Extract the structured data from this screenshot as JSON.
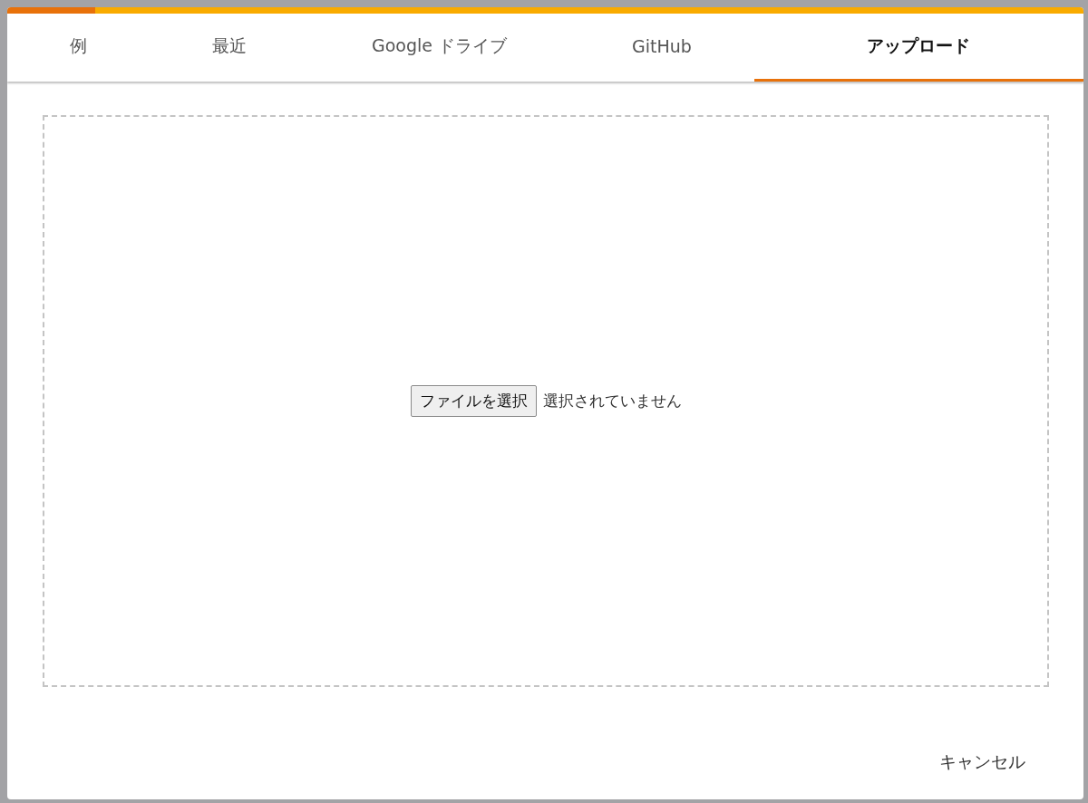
{
  "tabs": [
    {
      "label": "例",
      "selected": false
    },
    {
      "label": "最近",
      "selected": false
    },
    {
      "label": "Google ドライブ",
      "selected": false
    },
    {
      "label": "GitHub",
      "selected": false
    },
    {
      "label": "アップロード",
      "selected": true
    }
  ],
  "upload": {
    "button": "ファイルを選択",
    "status": "選択されていません"
  },
  "buttons": [
    "キャンセル"
  ]
}
